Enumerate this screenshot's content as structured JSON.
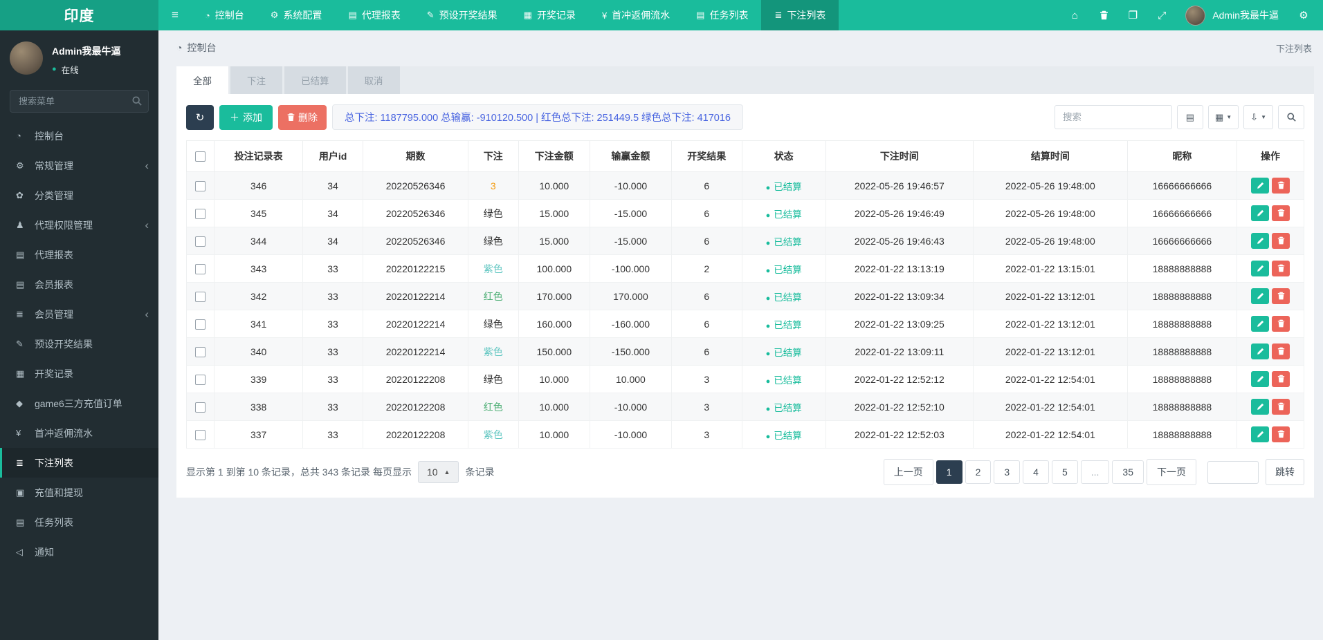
{
  "icons": {
    "menu": "≡",
    "dashboard": "◔",
    "gear": "⚙",
    "gears": "⚙",
    "book": "▤",
    "edit": "✎",
    "calendar": "▦",
    "yen": "¥",
    "list": "≣",
    "home": "⌂",
    "copy": "❐",
    "fullscreen": "⤢",
    "leaf": "✿",
    "users": "♟",
    "address-book": "▤",
    "gem": "◆",
    "card": "▣",
    "bullhorn": "◁",
    "chevron": "‹",
    "refresh": "↻",
    "caret-up": "▲",
    "caret-down": "▼",
    "dot": "●",
    "toggle-view": "▤",
    "columns": "▦",
    "export": "⇩",
    "plus": "＋",
    "trash": "🗑"
  },
  "colors": {
    "accent": "#1abc9c",
    "navbar_brand": "#16a085",
    "sidebar": "#222d32",
    "dark_btn": "#2c3e50",
    "danger_btn": "#ec7063",
    "status_settled": "#18bc9c",
    "summary_text": "#4763e0",
    "bet_orange": "#f39c12",
    "bet_teal": "#5dc5c0",
    "bet_green": "#4cae74"
  },
  "navbar": {
    "brand": "印度",
    "items": [
      {
        "label": "控制台",
        "icon": "dashboard"
      },
      {
        "label": "系统配置",
        "icon": "gear"
      },
      {
        "label": "代理报表",
        "icon": "book"
      },
      {
        "label": "预设开奖结果",
        "icon": "edit"
      },
      {
        "label": "开奖记录",
        "icon": "calendar"
      },
      {
        "label": "首冲返佣流水",
        "icon": "yen"
      },
      {
        "label": "任务列表",
        "icon": "book"
      },
      {
        "label": "下注列表",
        "icon": "list"
      }
    ],
    "active_item": "下注列表",
    "user_name": "Admin我最牛逼"
  },
  "sidebar": {
    "user_name": "Admin我最牛逼",
    "user_status": "在线",
    "search_placeholder": "搜索菜单",
    "items": [
      {
        "label": "控制台",
        "icon": "dashboard"
      },
      {
        "label": "常规管理",
        "icon": "gears",
        "submenu": true
      },
      {
        "label": "分类管理",
        "icon": "leaf"
      },
      {
        "label": "代理权限管理",
        "icon": "users",
        "submenu": true
      },
      {
        "label": "代理报表",
        "icon": "book"
      },
      {
        "label": "会员报表",
        "icon": "address-book"
      },
      {
        "label": "会员管理",
        "icon": "list",
        "submenu": true
      },
      {
        "label": "预设开奖结果",
        "icon": "edit"
      },
      {
        "label": "开奖记录",
        "icon": "calendar"
      },
      {
        "label": "game6三方充值订单",
        "icon": "gem"
      },
      {
        "label": "首冲返佣流水",
        "icon": "yen"
      },
      {
        "label": "下注列表",
        "icon": "list",
        "active": true
      },
      {
        "label": "充值和提现",
        "icon": "card"
      },
      {
        "label": "任务列表",
        "icon": "book"
      },
      {
        "label": "通知",
        "icon": "bullhorn"
      }
    ]
  },
  "breadcrumb": {
    "title": "控制台",
    "page": "下注列表"
  },
  "tabs": [
    {
      "label": "全部"
    },
    {
      "label": "下注"
    },
    {
      "label": "已结算"
    },
    {
      "label": "取消"
    }
  ],
  "active_tab": "全部",
  "toolbar": {
    "add_label": "添加",
    "delete_label": "删除",
    "summary": "总下注: 1187795.000 总输赢: -910120.500 | 红色总下注: 251449.5 绿色总下注: 417016",
    "search_placeholder": "搜索"
  },
  "table": {
    "columns": [
      "投注记录表",
      "用户id",
      "期数",
      "下注",
      "下注金额",
      "输赢金额",
      "开奖结果",
      "状态",
      "下注时间",
      "结算时间",
      "昵称",
      "操作"
    ],
    "status_label": "已结算",
    "rows": [
      {
        "id": "346",
        "uid": "34",
        "period": "20220526346",
        "bet": "3",
        "bet_color": "orange",
        "amount": "10.000",
        "winloss": "-10.000",
        "result": "6",
        "bet_time": "2022-05-26 19:46:57",
        "settle_time": "2022-05-26 19:48:00",
        "nickname": "16666666666"
      },
      {
        "id": "345",
        "uid": "34",
        "period": "20220526346",
        "bet": "绿色",
        "bet_color": "dark",
        "amount": "15.000",
        "winloss": "-15.000",
        "result": "6",
        "bet_time": "2022-05-26 19:46:49",
        "settle_time": "2022-05-26 19:48:00",
        "nickname": "16666666666"
      },
      {
        "id": "344",
        "uid": "34",
        "period": "20220526346",
        "bet": "绿色",
        "bet_color": "dark",
        "amount": "15.000",
        "winloss": "-15.000",
        "result": "6",
        "bet_time": "2022-05-26 19:46:43",
        "settle_time": "2022-05-26 19:48:00",
        "nickname": "16666666666"
      },
      {
        "id": "343",
        "uid": "33",
        "period": "20220122215",
        "bet": "紫色",
        "bet_color": "teal",
        "amount": "100.000",
        "winloss": "-100.000",
        "result": "2",
        "bet_time": "2022-01-22 13:13:19",
        "settle_time": "2022-01-22 13:15:01",
        "nickname": "18888888888"
      },
      {
        "id": "342",
        "uid": "33",
        "period": "20220122214",
        "bet": "红色",
        "bet_color": "green",
        "amount": "170.000",
        "winloss": "170.000",
        "result": "6",
        "bet_time": "2022-01-22 13:09:34",
        "settle_time": "2022-01-22 13:12:01",
        "nickname": "18888888888"
      },
      {
        "id": "341",
        "uid": "33",
        "period": "20220122214",
        "bet": "绿色",
        "bet_color": "dark",
        "amount": "160.000",
        "winloss": "-160.000",
        "result": "6",
        "bet_time": "2022-01-22 13:09:25",
        "settle_time": "2022-01-22 13:12:01",
        "nickname": "18888888888"
      },
      {
        "id": "340",
        "uid": "33",
        "period": "20220122214",
        "bet": "紫色",
        "bet_color": "teal",
        "amount": "150.000",
        "winloss": "-150.000",
        "result": "6",
        "bet_time": "2022-01-22 13:09:11",
        "settle_time": "2022-01-22 13:12:01",
        "nickname": "18888888888"
      },
      {
        "id": "339",
        "uid": "33",
        "period": "20220122208",
        "bet": "绿色",
        "bet_color": "dark",
        "amount": "10.000",
        "winloss": "10.000",
        "result": "3",
        "bet_time": "2022-01-22 12:52:12",
        "settle_time": "2022-01-22 12:54:01",
        "nickname": "18888888888"
      },
      {
        "id": "338",
        "uid": "33",
        "period": "20220122208",
        "bet": "红色",
        "bet_color": "green",
        "amount": "10.000",
        "winloss": "-10.000",
        "result": "3",
        "bet_time": "2022-01-22 12:52:10",
        "settle_time": "2022-01-22 12:54:01",
        "nickname": "18888888888"
      },
      {
        "id": "337",
        "uid": "33",
        "period": "20220122208",
        "bet": "紫色",
        "bet_color": "teal",
        "amount": "10.000",
        "winloss": "-10.000",
        "result": "3",
        "bet_time": "2022-01-22 12:52:03",
        "settle_time": "2022-01-22 12:54:01",
        "nickname": "18888888888"
      }
    ]
  },
  "pagination": {
    "info_prefix": "显示第 1 到第 10 条记录，总共 343 条记录 每页显示",
    "per_page": "10",
    "info_suffix": "条记录",
    "prev": "上一页",
    "next": "下一页",
    "pages": [
      "1",
      "2",
      "3",
      "4",
      "5",
      "...",
      "35"
    ],
    "active": "1",
    "jump": "跳转"
  }
}
